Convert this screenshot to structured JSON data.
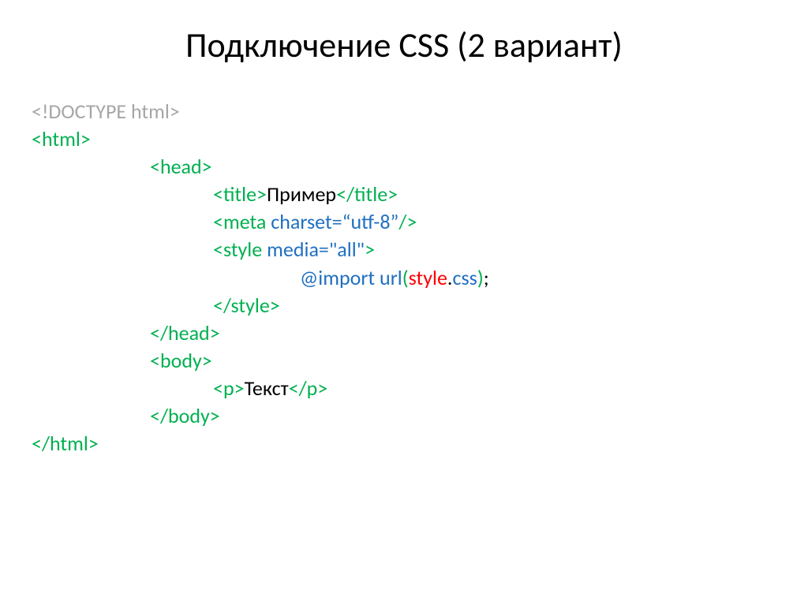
{
  "title": "Подключение CSS (2 вариант)",
  "code": {
    "doctype_lt": "<",
    "doctype_body": "!DOCTYPE html",
    "doctype_gt": ">",
    "html_open": "<html>",
    "head_open": "<head>",
    "title_open": "<title>",
    "title_text": "Пример",
    "title_close": "</title>",
    "meta_open": "<meta",
    "meta_space": " ",
    "meta_attr": "charset=“utf-8”",
    "meta_close": "/>",
    "style_open": "<style",
    "style_space": " ",
    "style_attr": "media=\"all\"",
    "style_gt": ">",
    "import_at": "@import",
    "import_space": " ",
    "import_url": "url",
    "import_lparen": "(",
    "import_file": "style",
    "import_dot": ".",
    "import_ext": "css",
    "import_rparen": ")",
    "import_semi": ";",
    "style_close": "</style>",
    "head_close": "</head>",
    "body_open": "<body>",
    "p_open": "<p>",
    "p_text": "Текст",
    "p_close": "</p>",
    "body_close": "</body>",
    "html_close": "</html>"
  }
}
